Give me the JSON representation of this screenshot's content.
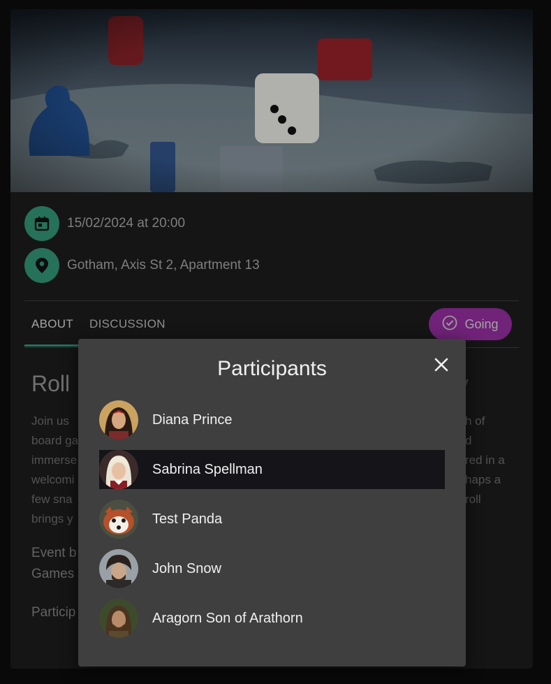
{
  "event": {
    "date_text": "15/02/2024 at 20:00",
    "location_text": "Gotham, Axis St 2, Apartment 13",
    "title_start": "Roll",
    "title_end_fragment": "y",
    "description_left": [
      "Join us",
      "board ga",
      "immerse",
      "welcomi",
      "few sna",
      "brings y"
    ],
    "description_right": [
      "h of",
      "d",
      "red in a",
      "haps a",
      "roll",
      ""
    ],
    "event_by_fragment": [
      "Event b",
      "Games"
    ],
    "participants_fragment": "Particip"
  },
  "tabs": [
    {
      "label": "ABOUT",
      "active": true
    },
    {
      "label": "DISCUSSION",
      "active": false
    }
  ],
  "going_button": {
    "label": "Going"
  },
  "modal": {
    "title": "Participants",
    "participants": [
      {
        "name": "Diana Prince",
        "highlighted": false
      },
      {
        "name": "Sabrina Spellman",
        "highlighted": true
      },
      {
        "name": "Test Panda",
        "highlighted": false
      },
      {
        "name": "John Snow",
        "highlighted": false
      },
      {
        "name": "Aragorn Son of Arathorn",
        "highlighted": false
      }
    ]
  },
  "icons": {
    "date": "calendar-icon",
    "location": "location-pin-icon",
    "going": "check-circle-icon",
    "close": "close-icon"
  },
  "colors": {
    "accent_green": "#2f8a6e",
    "going_purple": "#8a2a94",
    "modal_bg": "#3f3f40"
  }
}
